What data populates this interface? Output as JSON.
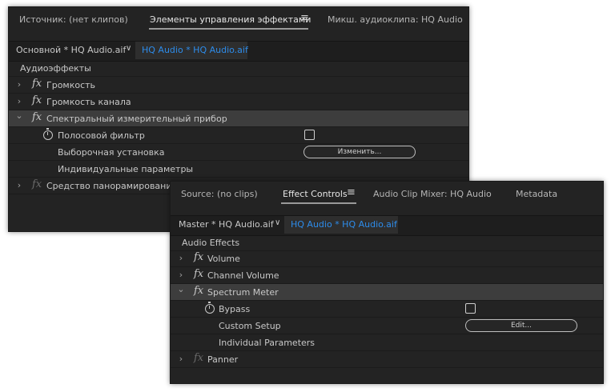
{
  "ru": {
    "tabs": {
      "source": "Источник: (нет клипов)",
      "effect_controls": "Элементы управления эффектами",
      "mixer": "Микш. аудиоклипа: HQ Audio"
    },
    "menu_icon": "≡",
    "header": {
      "master": "Основной * HQ Audio.aif",
      "clip": "HQ Audio * HQ Audio.aif"
    },
    "section": "Аудиоэффекты",
    "effects": {
      "volume": "Громкость",
      "channel_volume": "Громкость канала",
      "spectrum": "Спектральный измерительный прибор",
      "bypass": "Полосовой фильтр",
      "custom_setup": "Выборочная установка",
      "edit": "Изменить...",
      "individual": "Индивидуальные параметры",
      "panner": "Средство панорамирования"
    }
  },
  "en": {
    "tabs": {
      "source": "Source: (no clips)",
      "effect_controls": "Effect Controls",
      "mixer": "Audio Clip Mixer: HQ Audio",
      "metadata": "Metadata"
    },
    "menu_icon": "≡",
    "header": {
      "master": "Master * HQ Audio.aif",
      "clip": "HQ Audio * HQ Audio.aif"
    },
    "section": "Audio Effects",
    "effects": {
      "volume": "Volume",
      "channel_volume": "Channel Volume",
      "spectrum": "Spectrum Meter",
      "bypass": "Bypass",
      "custom_setup": "Custom Setup",
      "edit": "Edit...",
      "individual": "Individual Parameters",
      "panner": "Panner"
    }
  },
  "glyphs": {
    "fx": "fx",
    "chevron_right": "›",
    "chevron_down": "⌄",
    "header_chevron": "∨"
  }
}
